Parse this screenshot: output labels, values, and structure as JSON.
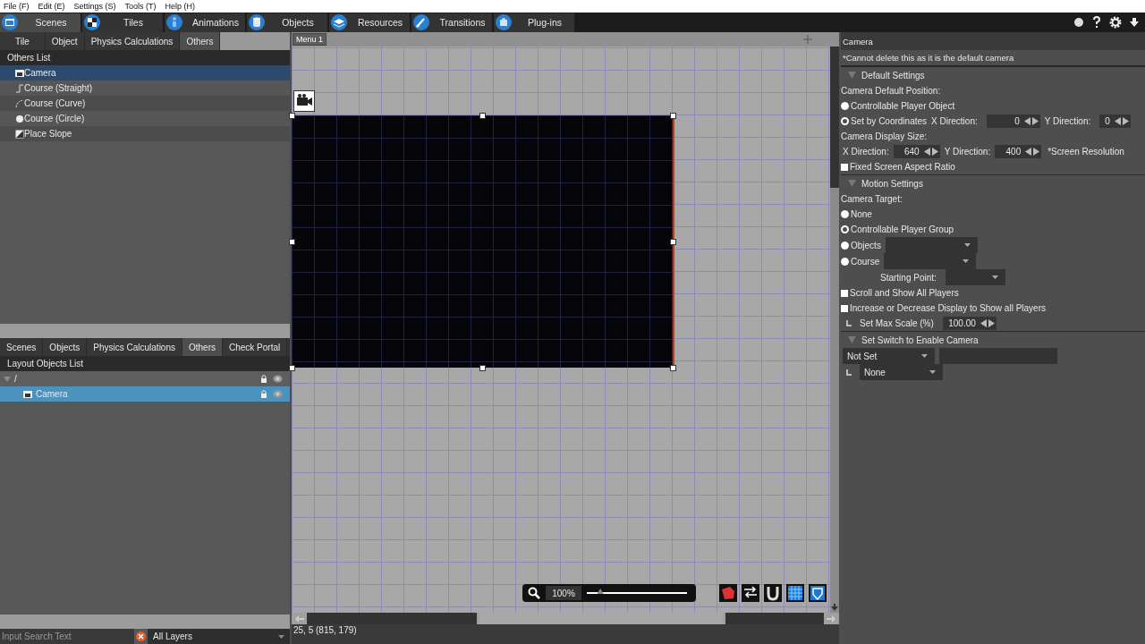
{
  "menu_bar": [
    {
      "label": "File (F)"
    },
    {
      "label": "Edit (E)"
    },
    {
      "label": "Settings (S)"
    },
    {
      "label": "Tools (T)"
    },
    {
      "label": "Help (H)"
    }
  ],
  "main_tabs": [
    {
      "label": "Scenes",
      "selected": true
    },
    {
      "label": "Tiles",
      "selected": false
    },
    {
      "label": "Animations",
      "selected": false
    },
    {
      "label": "Objects",
      "selected": false
    },
    {
      "label": "Resources",
      "selected": false
    },
    {
      "label": "Transitions",
      "selected": false
    },
    {
      "label": "Plug-ins",
      "selected": false
    }
  ],
  "palette_tabs": [
    {
      "label": "Tile",
      "selected": false
    },
    {
      "label": "Object",
      "selected": false
    },
    {
      "label": "Physics Calculations",
      "selected": false
    },
    {
      "label": "Others",
      "selected": true
    }
  ],
  "others_list": {
    "title": "Others List",
    "items": [
      {
        "label": "Camera",
        "kind": "camera",
        "selected": true
      },
      {
        "label": "Course (Straight)",
        "kind": "straight",
        "selected": false
      },
      {
        "label": "Course (Curve)",
        "kind": "curve",
        "selected": false
      },
      {
        "label": "Course (Circle)",
        "kind": "circle",
        "selected": false
      },
      {
        "label": "Place Slope",
        "kind": "slope",
        "selected": false
      }
    ]
  },
  "layout_tabs": [
    {
      "label": "Scenes",
      "selected": false
    },
    {
      "label": "Objects",
      "selected": false
    },
    {
      "label": "Physics Calculations",
      "selected": false
    },
    {
      "label": "Others",
      "selected": true
    },
    {
      "label": "Check Portal",
      "selected": false
    }
  ],
  "layout_list": {
    "title": "Layout Objects List",
    "tree": [
      {
        "label": "/",
        "expanded": true,
        "selected": false,
        "children": [
          {
            "label": "Camera",
            "selected": true
          }
        ]
      }
    ]
  },
  "search": {
    "placeholder": "Input Search Text"
  },
  "layer_filter": {
    "value": "All Layers"
  },
  "canvas": {
    "tabs": [
      {
        "label": "Menu 1",
        "selected": true
      }
    ],
    "zoom": {
      "value": "100%",
      "level": 0.13
    },
    "status": "25, 5 (815, 179)"
  },
  "inspector": {
    "title": "Camera",
    "note": "*Cannot delete this as it is the default camera",
    "sections": [
      {
        "title": "Default Settings",
        "expanded": true,
        "rows": [
          {
            "kind": "label",
            "text": "Camera Default Position:"
          },
          {
            "kind": "radio",
            "label": "Controllable Player Object",
            "selected": false
          },
          {
            "kind": "radio",
            "label": "Set by Coordinates",
            "selected": true,
            "controls": [
              {
                "kind": "spinner",
                "label": "X Direction:",
                "value": "0"
              },
              {
                "kind": "spinner",
                "label": "Y Direction:",
                "value": "0"
              }
            ]
          },
          {
            "kind": "label",
            "text": "Camera Display Size:"
          },
          {
            "kind": "fields",
            "controls": [
              {
                "kind": "spinner",
                "label": "X Direction:",
                "value": "640"
              },
              {
                "kind": "spinner",
                "label": "Y Direction:",
                "value": "400"
              },
              {
                "kind": "text",
                "text": "*Screen Resolution"
              }
            ]
          },
          {
            "kind": "checkbox",
            "label": "Fixed Screen Aspect Ratio",
            "checked": false
          }
        ]
      },
      {
        "title": "Motion Settings",
        "expanded": true,
        "rows": [
          {
            "kind": "label",
            "text": "Camera Target:"
          },
          {
            "kind": "radio",
            "label": "None",
            "selected": false
          },
          {
            "kind": "radio",
            "label": "Controllable Player Group",
            "selected": true
          },
          {
            "kind": "radio",
            "label": "Objects",
            "selected": false,
            "controls": [
              {
                "kind": "dropdown"
              }
            ]
          },
          {
            "kind": "radio",
            "label": "Course",
            "selected": false,
            "controls": [
              {
                "kind": "dropdown"
              }
            ]
          },
          {
            "kind": "indented",
            "controls": [
              {
                "kind": "dropdown",
                "label": "Starting Point:"
              }
            ]
          },
          {
            "kind": "checkbox",
            "label": "Scroll and Show All Players",
            "checked": false
          },
          {
            "kind": "checkbox",
            "label": "Increase or Decrease Display to Show all Players",
            "checked": false
          },
          {
            "kind": "branch",
            "controls": [
              {
                "kind": "spinner",
                "label": "Set Max Scale (%)",
                "value": "100.00"
              }
            ]
          }
        ]
      },
      {
        "title": "Set Switch to Enable Camera",
        "expanded": true,
        "rows": [
          {
            "kind": "fields",
            "controls": [
              {
                "kind": "dropdown",
                "value": "Not Set"
              },
              {
                "kind": "input"
              }
            ]
          },
          {
            "kind": "branch",
            "controls": [
              {
                "kind": "dropdown",
                "value": "None"
              }
            ]
          }
        ]
      }
    ]
  }
}
